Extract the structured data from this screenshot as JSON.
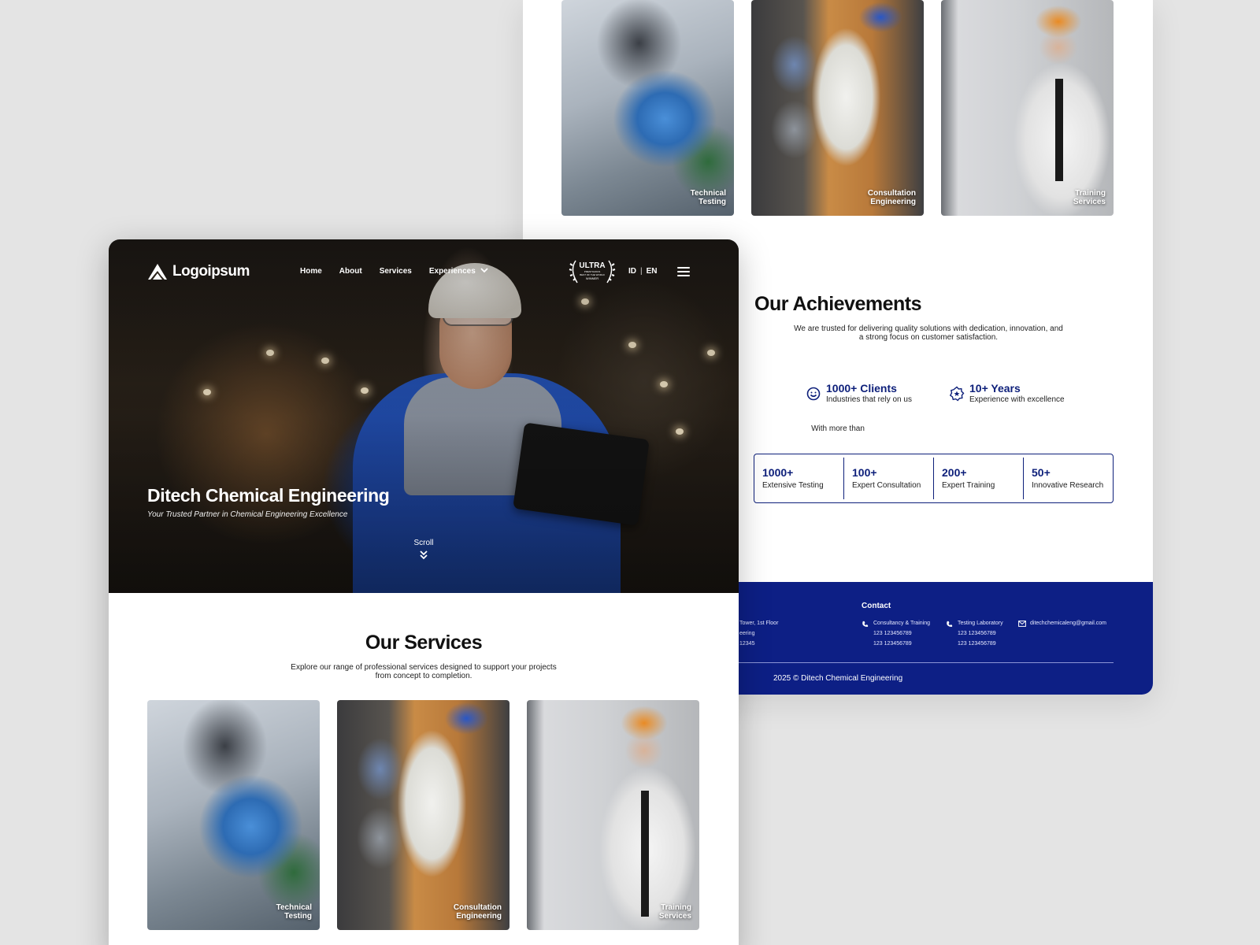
{
  "brand": {
    "logo_text": "Logoipsum"
  },
  "nav": {
    "links": [
      "Home",
      "About",
      "Services",
      "Experiences"
    ],
    "award": {
      "line1": "ULTRA",
      "line2": "PRESTIGIOUS",
      "line3": "BEST OF THE WORLD",
      "line4": "WINNER"
    },
    "lang": {
      "id": "ID",
      "sep": "|",
      "en": "EN"
    }
  },
  "hero": {
    "title": "Ditech Chemical Engineering",
    "subtitle": "Your Trusted Partner in Chemical Engineering Excellence",
    "scroll_label": "Scroll"
  },
  "services": {
    "title": "Our Services",
    "description": "Explore our range of professional services designed to support your projects from concept to completion.",
    "cards": [
      {
        "label_line1": "Technical",
        "label_line2": "Testing"
      },
      {
        "label_line1": "Consultation",
        "label_line2": "Engineering"
      },
      {
        "label_line1": "Training",
        "label_line2": "Services"
      }
    ]
  },
  "achievements": {
    "title": "Our Achievements",
    "description": "We are trusted for delivering quality solutions with dedication, innovation, and a strong focus on customer satisfaction.",
    "highlights": [
      {
        "value": "1000+ Clients",
        "caption": "Industries that rely on us",
        "icon": "smile-icon"
      },
      {
        "value": "10+ Years",
        "caption": "Experience with excellence",
        "icon": "badge-star-icon"
      }
    ],
    "with_more": "With more than",
    "stats": [
      {
        "value": "1000+",
        "label": "Extensive Testing"
      },
      {
        "value": "100+",
        "label": "Expert Consultation"
      },
      {
        "value": "200+",
        "label": "Expert Training"
      },
      {
        "value": "50+",
        "label": "Innovative Research"
      }
    ]
  },
  "footer": {
    "address_fragments": [
      "Tower, 1st Floor",
      "eering",
      "12345"
    ],
    "contact_title": "Contact",
    "contacts": [
      {
        "name": "Consultancy & Training",
        "phone1": "123 123456789",
        "phone2": "123 123456789"
      },
      {
        "name": "Testing Laboratory",
        "phone1": "123 123456789",
        "phone2": "123 123456789"
      }
    ],
    "email": "ditechchemicaleng@gmail.com",
    "copyright": "2025 © Ditech Chemical Engineering"
  },
  "colors": {
    "primary_navy": "#0d1f85",
    "accent_text": "#0d1f7a",
    "page_bg": "#e4e4e4"
  }
}
